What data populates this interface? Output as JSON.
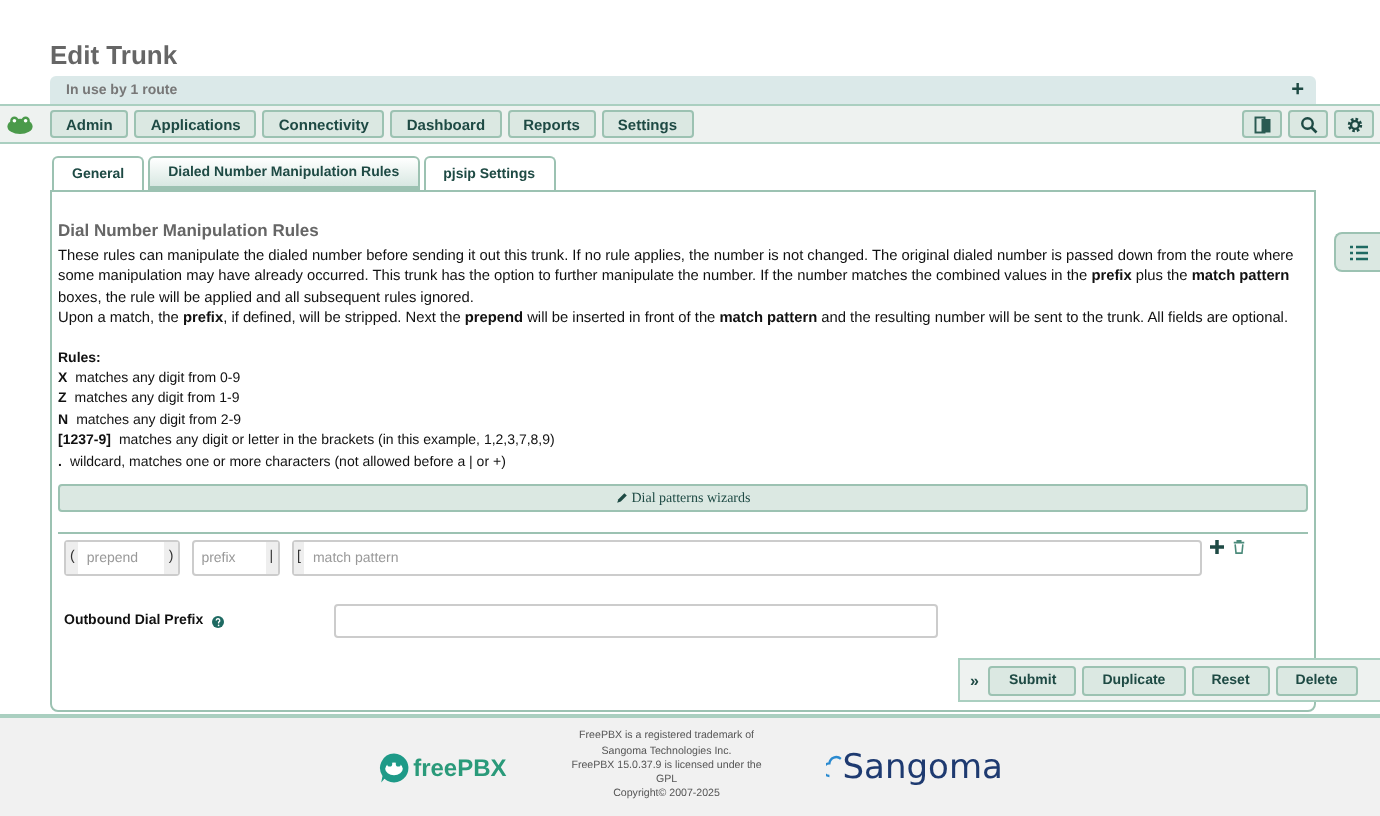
{
  "page_title": "Edit Trunk",
  "usage_bar": {
    "text": "In use by 1 route",
    "toggle": "+"
  },
  "nav": {
    "items": [
      "Admin",
      "Applications",
      "Connectivity",
      "Dashboard",
      "Reports",
      "Settings"
    ]
  },
  "tabs": [
    {
      "label": "General",
      "selected": false
    },
    {
      "label": "Dialed Number Manipulation Rules",
      "selected": true
    },
    {
      "label": "pjsip Settings",
      "selected": false
    }
  ],
  "section_title": "Dial Number Manipulation Rules",
  "paragraphs": [
    "These rules can manipulate the dialed number before sending it out this trunk. If no rule applies, the number is not changed. The original dialed number is passed down from the route where some manipulation may have already occurred. This trunk has the option to further manipulate the number. If the number matches the combined values in the **prefix** plus the **match pattern** boxes, the rule will be applied and all subsequent rules ignored.",
    "Upon a match, the **prefix**, if defined, will be stripped. Next the **prepend** will be inserted in front of the **match pattern** and the resulting number will be sent to the trunk. All fields are optional."
  ],
  "rules_heading": "Rules:",
  "rules": [
    {
      "symbol": "X",
      "text": "matches any digit from 0-9"
    },
    {
      "symbol": "Z",
      "text": "matches any digit from 1-9"
    },
    {
      "symbol": "N",
      "text": "matches any digit from 2-9"
    },
    {
      "symbol": "[1237-9]",
      "text": "matches any digit or letter in the brackets (in this example, 1,2,3,7,8,9)"
    },
    {
      "symbol": ".",
      "text": "wildcard, matches one or more characters (not allowed before a | or +)"
    }
  ],
  "wizard_button": "Dial patterns wizards",
  "pattern_row": {
    "prepend_open": "(",
    "prepend_placeholder": "prepend",
    "prepend_close": ")",
    "prefix_placeholder": "prefix",
    "prefix_sep": "|",
    "match_open": "[",
    "match_placeholder": "match pattern"
  },
  "outbound_prefix_label": "Outbound Dial Prefix",
  "action_bar": {
    "toggle": "»",
    "buttons": [
      "Submit",
      "Duplicate",
      "Reset",
      "Delete"
    ]
  },
  "footer": {
    "logo_text": "freePBX",
    "legal": [
      "FreePBX is a registered trademark of",
      "Sangoma Technologies Inc.",
      "FreePBX 15.0.37.9 is licensed under the",
      "GPL",
      "Copyright© 2007-2025"
    ],
    "brand": "Sangoma"
  }
}
